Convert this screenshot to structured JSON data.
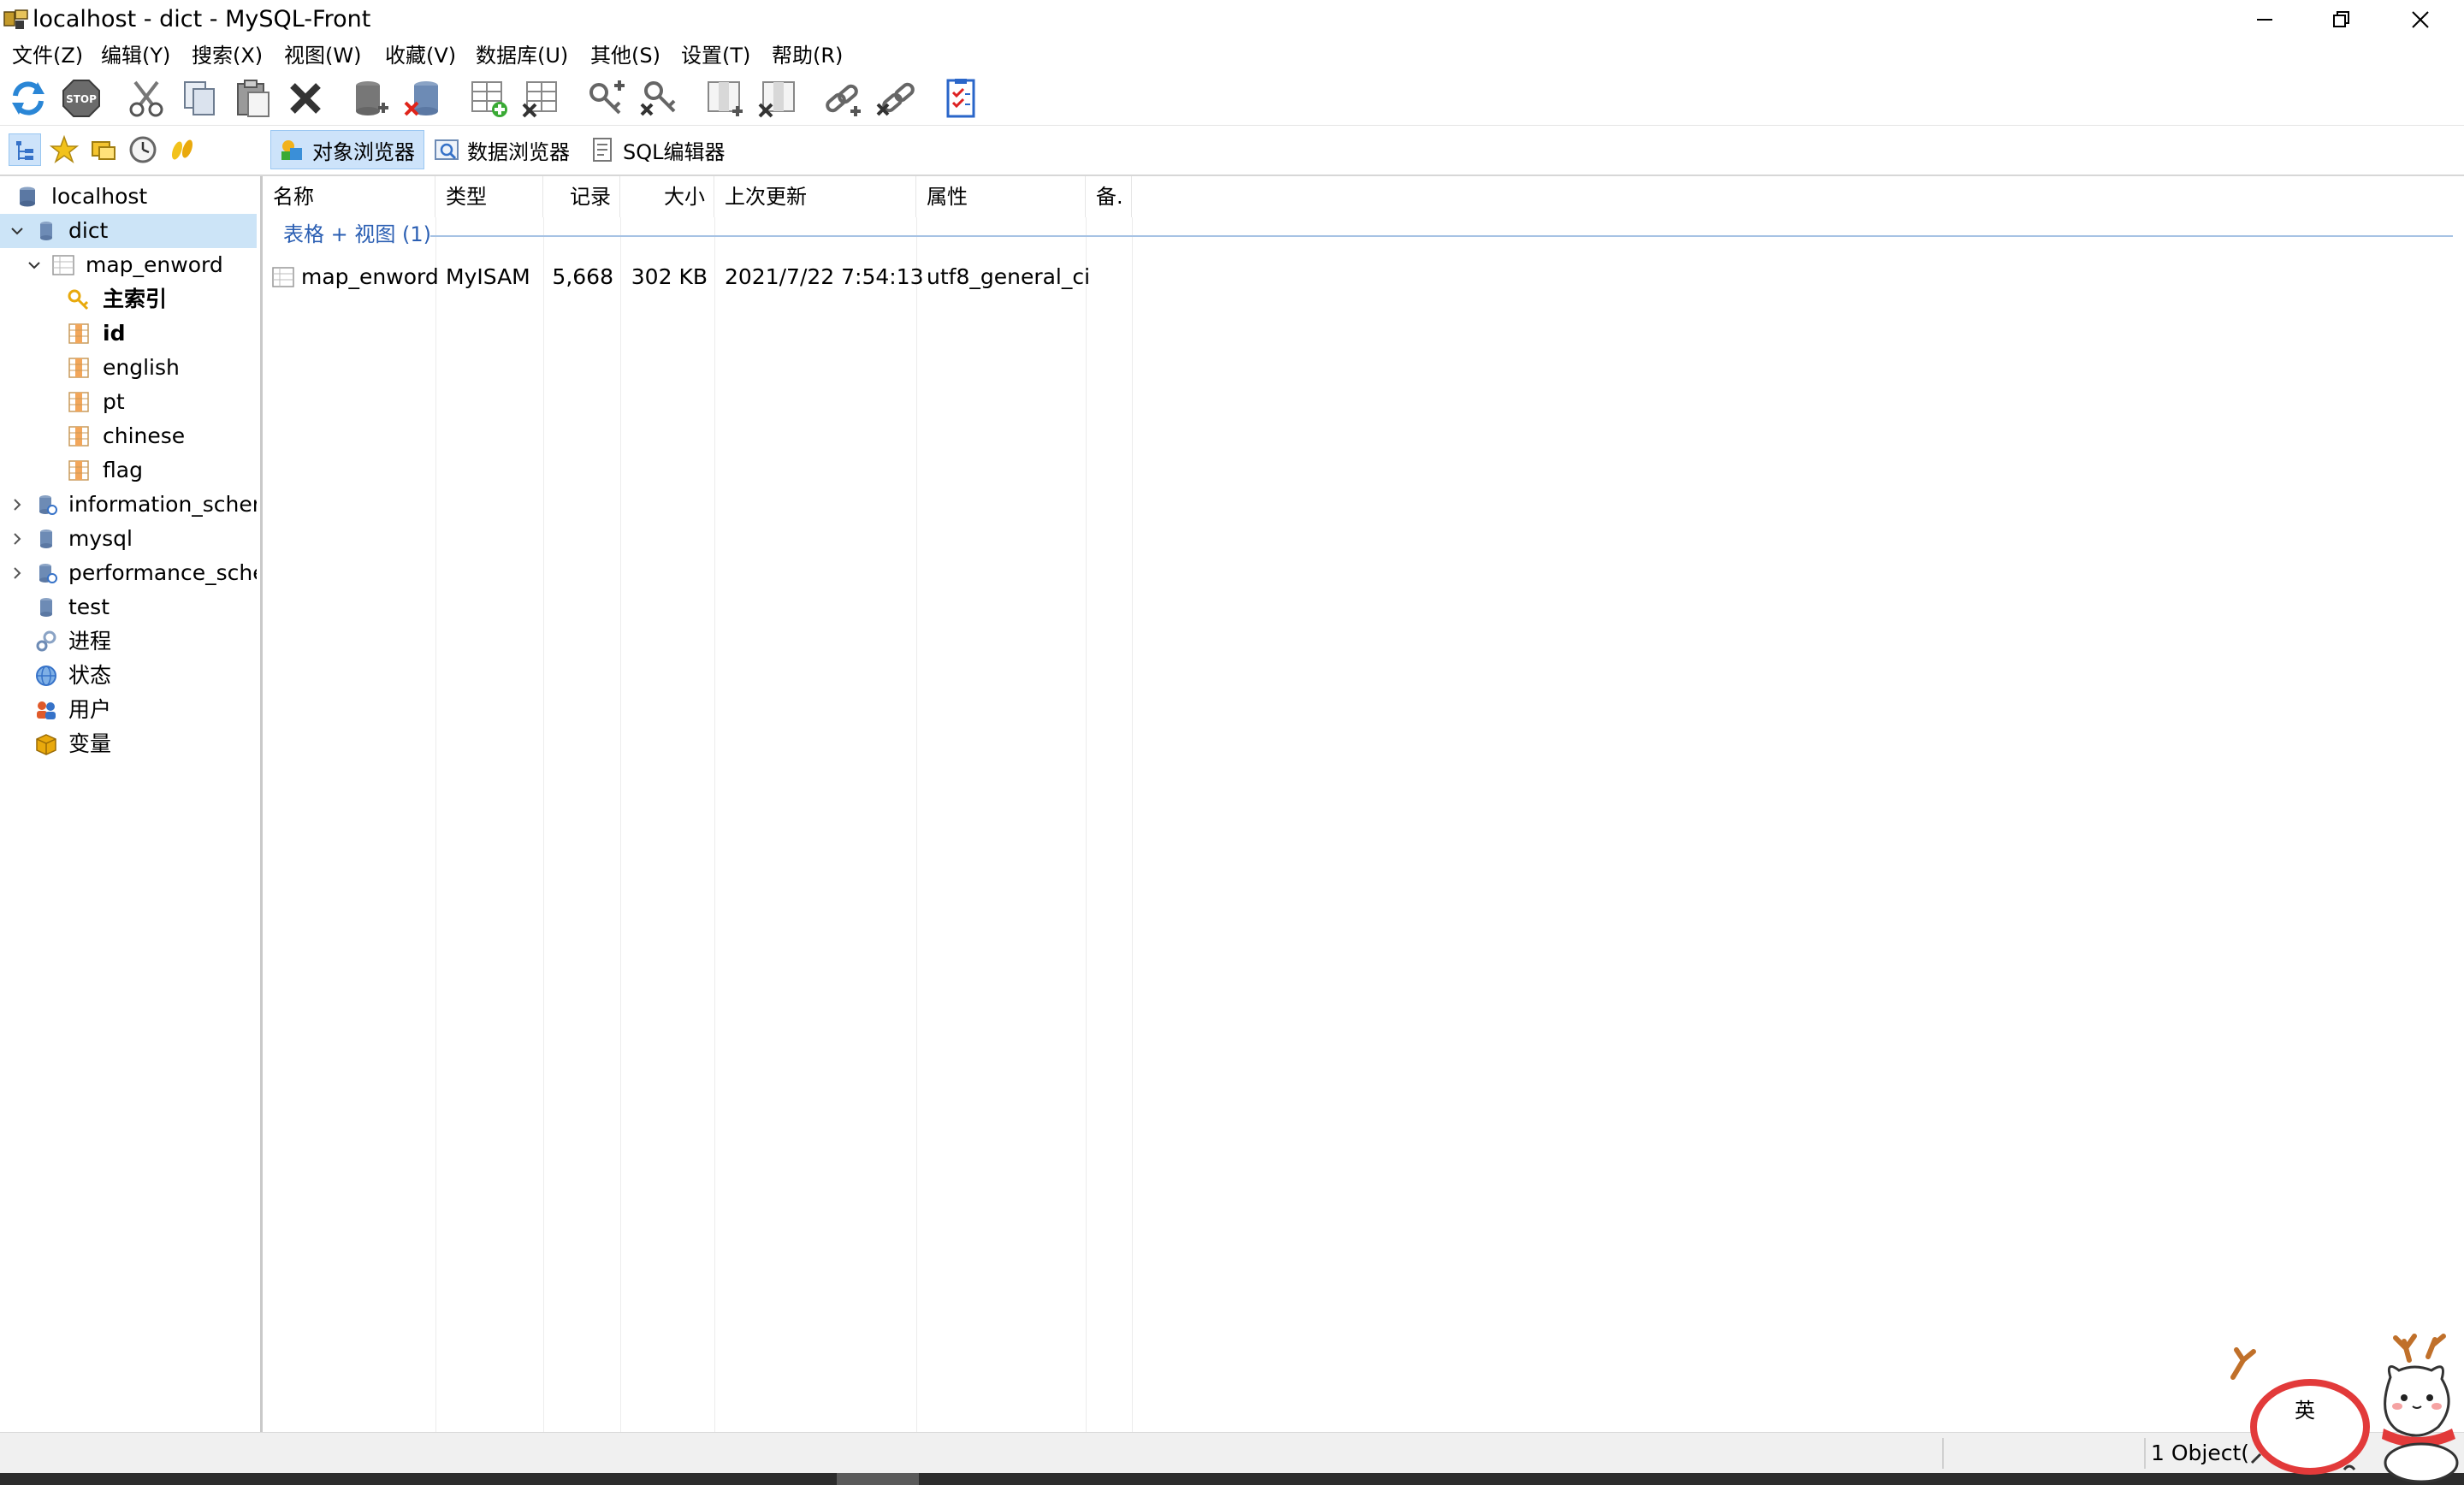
{
  "window": {
    "title": "localhost - dict - MySQL-Front",
    "controls": {
      "minimize_icon": "minimize-icon",
      "restore_icon": "restore-icon",
      "close_icon": "close-icon"
    }
  },
  "menu": [
    {
      "label": "文件(Z)"
    },
    {
      "label": "编辑(Y)"
    },
    {
      "label": "搜索(X)"
    },
    {
      "label": "视图(W)"
    },
    {
      "label": "收藏(V)"
    },
    {
      "label": "数据库(U)"
    },
    {
      "label": "其他(S)"
    },
    {
      "label": "设置(T)"
    },
    {
      "label": "帮助(R)"
    }
  ],
  "toolbar": {
    "icons": [
      "refresh-icon",
      "stop-icon",
      "cut-icon",
      "copy-icon",
      "paste-icon",
      "delete-icon",
      "database-add-icon",
      "database-delete-icon",
      "table-add-icon",
      "table-delete-icon",
      "key-add-icon",
      "key-delete-icon",
      "field-add-icon",
      "field-delete-icon",
      "link-add-icon",
      "link-delete-icon",
      "checklist-icon"
    ]
  },
  "subbar": {
    "icons": [
      "tree-view-icon",
      "favorites-icon",
      "bookmarks-icon",
      "history-icon",
      "sql-history-icon"
    ],
    "tabs": [
      {
        "label": "对象浏览器",
        "active": true,
        "icon": "object-browser-icon"
      },
      {
        "label": "数据浏览器",
        "active": false,
        "icon": "data-browser-icon"
      },
      {
        "label": "SQL编辑器",
        "active": false,
        "icon": "sql-editor-icon"
      }
    ]
  },
  "tree": {
    "items": [
      {
        "label": "localhost",
        "icon": "server-icon",
        "level": 0
      },
      {
        "label": "dict",
        "icon": "database-icon",
        "level": 1,
        "expanded": true,
        "selected": true
      },
      {
        "label": "map_enword",
        "icon": "table-icon",
        "level": 2,
        "expanded": true
      },
      {
        "label": "主索引",
        "icon": "index-key-icon",
        "level": 3
      },
      {
        "label": "id",
        "icon": "column-icon",
        "level": 3
      },
      {
        "label": "english",
        "icon": "column-icon",
        "level": 3
      },
      {
        "label": "pt",
        "icon": "column-icon",
        "level": 3
      },
      {
        "label": "chinese",
        "icon": "column-icon",
        "level": 3
      },
      {
        "label": "flag",
        "icon": "column-icon",
        "level": 3
      },
      {
        "label": "information_schem",
        "icon": "system-database-icon",
        "level": 1
      },
      {
        "label": "mysql",
        "icon": "database-icon",
        "level": 1
      },
      {
        "label": "performance_scher",
        "icon": "system-database-icon",
        "level": 1
      },
      {
        "label": "test",
        "icon": "database-icon",
        "level": 1
      },
      {
        "label": "进程",
        "icon": "processes-icon",
        "level": 1
      },
      {
        "label": "状态",
        "icon": "status-globe-icon",
        "level": 1
      },
      {
        "label": "用户",
        "icon": "users-icon",
        "level": 1
      },
      {
        "label": "变量",
        "icon": "variables-icon",
        "level": 1
      }
    ]
  },
  "list": {
    "columns": [
      "名称",
      "类型",
      "记录",
      "大小",
      "上次更新",
      "属性",
      "备."
    ],
    "group_label": "表格 + 视图 (1)",
    "rows": [
      {
        "name": "map_enword",
        "type": "MyISAM",
        "records": "5,668",
        "size": "302 KB",
        "updated": "2021/7/22 7:54:13",
        "collation": "utf8_general_ci",
        "comment": ""
      }
    ]
  },
  "statusbar": {
    "text": "1 Object("
  },
  "overlay": {
    "ime_char": "英"
  },
  "colors": {
    "selection": "#cce4f7",
    "tab_active": "#cde3fa",
    "group_text": "#2b5fb3",
    "group_line": "#a6c2e4"
  }
}
